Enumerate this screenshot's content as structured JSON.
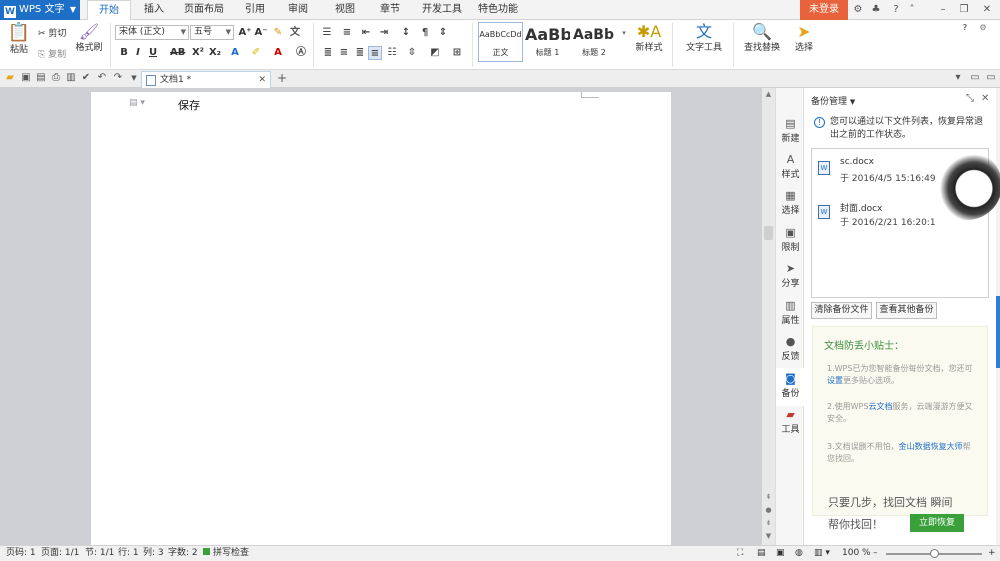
{
  "app": {
    "logo_glyph": "W",
    "name": "WPS 文字"
  },
  "ribbon_tabs": [
    "开始",
    "插入",
    "页面布局",
    "引用",
    "审阅",
    "视图",
    "章节",
    "开发工具",
    "特色功能"
  ],
  "active_tab": "开始",
  "title_right": {
    "login_label": "未登录"
  },
  "ribbon": {
    "paste": "粘贴",
    "cut": "剪切",
    "copy": "复制",
    "format_painter": "格式刷",
    "font_name": "宋体 (正文)",
    "font_size": "五号",
    "styles": [
      {
        "preview": "AaBbCcDd",
        "name": "正文"
      },
      {
        "preview": "AaBb",
        "name": "标题 1"
      },
      {
        "preview": "AaBb(",
        "name": "标题 2"
      }
    ],
    "new_style": "新样式",
    "text_tool": "文字工具",
    "find_replace": "查找替换",
    "select": "选择"
  },
  "doc_tab": {
    "title": "文档1 *"
  },
  "document": {
    "text": "保存"
  },
  "right_tools": [
    "新建",
    "样式",
    "选择",
    "限制",
    "分享",
    "属性",
    "反馈",
    "备份",
    "工具"
  ],
  "right_tools_active": "备份",
  "panel": {
    "title": "备份管理",
    "info": "您可以通过以下文件列表，恢复异常退出之前的工作状态。",
    "files": [
      {
        "name": "sc.docx",
        "time": "于 2016/4/5 15:16:49"
      },
      {
        "name": "封面.docx",
        "time": "于 2016/2/21 16:20:1"
      }
    ],
    "clear_btn": "清除备份文件",
    "view_btn": "查看其他备份",
    "tips_title": "文档防丢小贴士：",
    "tip1_a": "1.WPS已为您智能备份每份文档，您还可",
    "tip1_link": "设置",
    "tip1_b": "更多贴心选项。",
    "tip2_a": "2.使用WPS",
    "tip2_link": "云文档",
    "tip2_b": "服务，云端漫游方便又安全。",
    "tip3_a": "3.文档误删不用怕，",
    "tip3_link": "金山数据恢复大师",
    "tip3_b": "帮您找回。",
    "promo_line1": "只要几步，找回文档 瞬间",
    "promo_line2": "帮你找回！",
    "promo_btn": "立即恢复"
  },
  "status": {
    "page_code": "页码: 1",
    "page": "页面: 1/1",
    "section": "节: 1/1",
    "row": "行: 1",
    "col": "列: 3",
    "word_count": "字数: 2",
    "spellcheck": "拼写检查",
    "zoom": "100 %"
  },
  "colors": {
    "accent": "#1e6fc7",
    "login": "#e8623c",
    "promo": "#3aa13a"
  }
}
